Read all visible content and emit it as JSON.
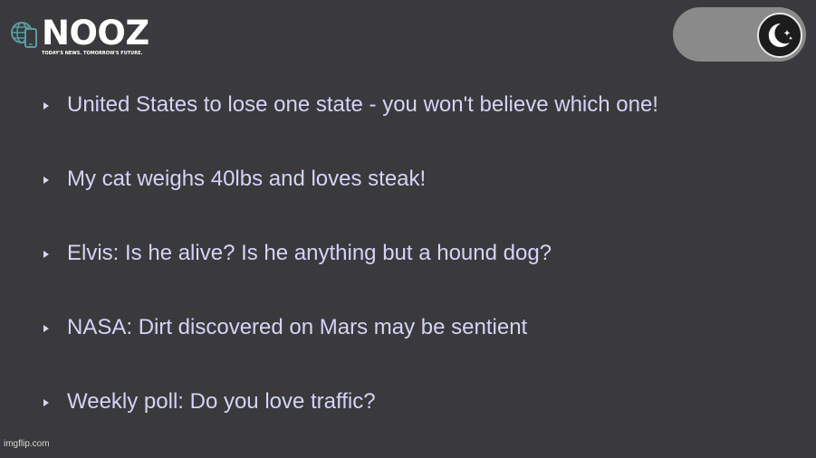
{
  "brand": {
    "name": "NOOZ",
    "tagline": "TODAY'S NEWS. TOMORROW'S FUTURE.",
    "icon": "globe-phone-icon"
  },
  "theme_toggle": {
    "icon": "moon-stars-icon",
    "mode": "dark"
  },
  "headlines": [
    {
      "text": "United States to lose one state - you won't believe which one!"
    },
    {
      "text": "My cat weighs 40lbs and loves steak!"
    },
    {
      "text": "Elvis: Is he alive? Is he anything but a hound dog?"
    },
    {
      "text": "NASA: Dirt discovered on Mars may be sentient"
    },
    {
      "text": "Weekly poll: Do you love traffic?"
    }
  ],
  "watermark": "imgflip.com",
  "colors": {
    "background": "#3a3a3c",
    "link": "#d3d3f8",
    "toggle_track": "#8a8a8a",
    "toggle_knob": "#1c1c1c",
    "logo_accent": "#5b9aa0"
  }
}
